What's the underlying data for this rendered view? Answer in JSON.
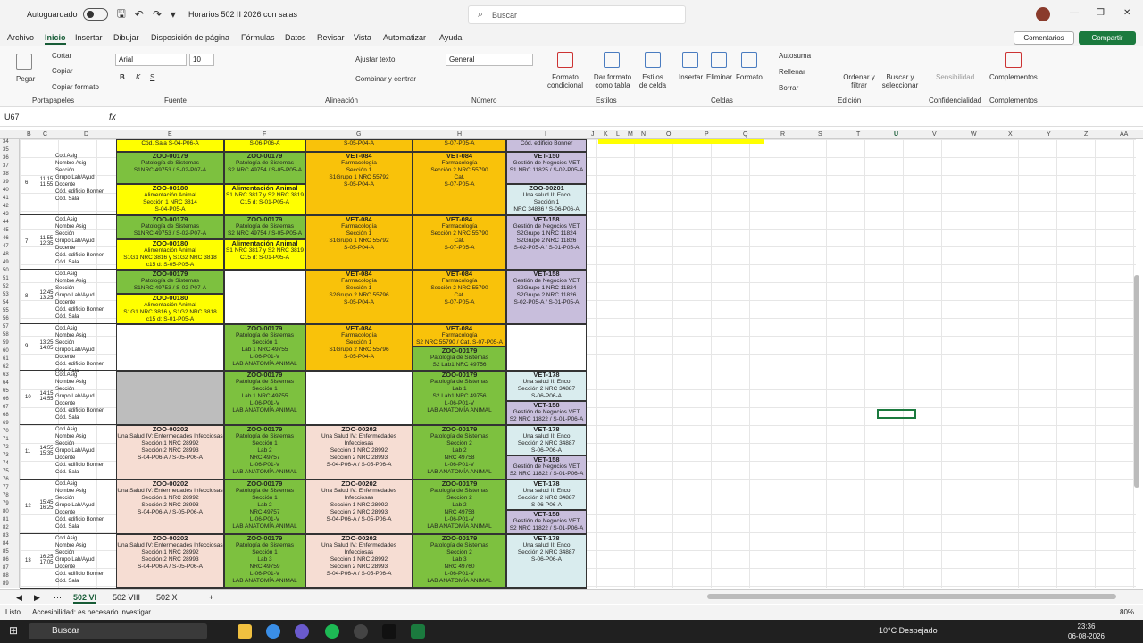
{
  "titlebar": {
    "autosave": "Autoguardado",
    "doc": "Horarios 502 II 2026 con salas",
    "search": "Buscar"
  },
  "menu": [
    "Archivo",
    "Inicio",
    "Insertar",
    "Dibujar",
    "Disposición de página",
    "Fórmulas",
    "Datos",
    "Revisar",
    "Vista",
    "Automatizar",
    "Ayuda"
  ],
  "buttons": {
    "comments": "Comentarios",
    "share": "Compartir"
  },
  "ribbon": {
    "paste": "Pegar",
    "cut": "Cortar",
    "copy": "Copiar",
    "format_copy": "Copiar formato",
    "clipboard": "Portapapeles",
    "font": "Arial",
    "size": "10",
    "font_group": "Fuente",
    "wrap": "Ajustar texto",
    "merge": "Combinar y centrar",
    "align_group": "Alineación",
    "numfmt": "General",
    "number_group": "Número",
    "cond": "Formato condicional",
    "table": "Dar formato como tabla",
    "styles_cell": "Estilos de celda",
    "styles_group": "Estilos",
    "insert": "Insertar",
    "delete": "Eliminar",
    "format": "Formato",
    "cells_group": "Celdas",
    "autosum": "Autosuma",
    "fill": "Rellenar",
    "clear": "Borrar",
    "sort": "Ordenar y filtrar",
    "find": "Buscar y seleccionar",
    "edit_group": "Edición",
    "sens": "Sensibilidad",
    "conf_group": "Confidencialidad",
    "addins": "Complementos",
    "addins_group": "Complementos"
  },
  "namebox": "U67",
  "columns": [
    "B",
    "C",
    "D",
    "E",
    "F",
    "G",
    "H",
    "I",
    "J",
    "K",
    "L",
    "M",
    "N",
    "O",
    "P",
    "Q",
    "R",
    "S",
    "T",
    "U",
    "V",
    "W",
    "X",
    "Y",
    "Z",
    "AA"
  ],
  "rows": [
    "34",
    "35",
    "36",
    "37",
    "38",
    "39",
    "40",
    "41",
    "42",
    "43",
    "44",
    "45",
    "46",
    "47",
    "48",
    "49",
    "50",
    "51",
    "52",
    "53",
    "54",
    "55",
    "56",
    "57",
    "58",
    "59",
    "60",
    "61",
    "62",
    "63",
    "64",
    "65",
    "66",
    "67",
    "68",
    "69",
    "70",
    "71",
    "72",
    "73",
    "74",
    "75",
    "76",
    "77",
    "78",
    "79",
    "80",
    "81",
    "82",
    "83",
    "84",
    "85",
    "86",
    "87",
    "88",
    "89"
  ],
  "row_labels": [
    "Cod.Asig",
    "Nombre Asig",
    "Sección",
    "Grupo Lab/Ayud",
    "Docente",
    "Cód. edificio Bonner",
    "Cód. Sala"
  ],
  "blocks": [
    {
      "num": "6",
      "time": "11:15 11:55"
    },
    {
      "num": "7",
      "time": "11:55 12:35"
    },
    {
      "num": "8",
      "time": "12:45 13:25"
    },
    {
      "num": "9",
      "time": "13:25 14:05"
    },
    {
      "num": "10",
      "time": "14:15 14:55"
    },
    {
      "num": "11",
      "time": "14:55 15:35"
    },
    {
      "num": "12",
      "time": "15:45 16:25"
    },
    {
      "num": "13",
      "time": "16:25 17:05"
    }
  ],
  "cells": {
    "top_e": "Cód. Sala S-04-P06-A",
    "top_f": "S-06-P06-A",
    "top_g": "S-05-P04-A",
    "top_h": "S-07-P05-A",
    "top_i": "Cód. edificio Bonner",
    "b6e1": [
      "ZOO-00179",
      "Patología de Sistemas",
      "S1NRC 49753 / S-02-P07-A"
    ],
    "b6e2": [
      "ZOO-00180",
      "Alimentación Animal",
      "Sección 1 NRC 3814",
      "S-04-P05-A"
    ],
    "b6f1": [
      "ZOO-00179",
      "Patología de Sistemas",
      "S2 NRC 49754 / S-05-P05-A"
    ],
    "b6f2": [
      "Alimentación Animal",
      "S1 NRC 3817 y S2 NRC 3819",
      "C15 d: S-01-P05-A"
    ],
    "b6g": [
      "VET-084",
      "Farmacología",
      "Sección 1",
      "S1Grupo 1 NRC 55792",
      "S-05-P04-A"
    ],
    "b6h": [
      "VET-084",
      "Farmacología",
      "Sección 2 NRC 55790",
      "Cat.",
      "S-07-P05-A"
    ],
    "b6i1": [
      "VET-150",
      "Gestión de Negocios VET",
      "S1 NRC 11825 / S-02-P05-A"
    ],
    "b6i2": [
      "ZOO-00201",
      "Una salud II: Enco",
      "Sección 1",
      "NRC 34886 / S-06-P06-A"
    ],
    "b7e1": [
      "ZOO-00179",
      "Patología de Sistemas",
      "S1NRC 49753 / S-02-P07-A"
    ],
    "b7e2": [
      "ZOO-00180",
      "Alimentación Animal",
      "S1G1 NRC 3816 y S1G2 NRC 3818",
      "c15 d: S-05-P05-A"
    ],
    "b7f1": [
      "ZOO-00179",
      "Patología de Sistemas",
      "S2 NRC 49754 / S-05-P05-A"
    ],
    "b7f2": [
      "Alimentación Animal",
      "S1 NRC 3817 y S2 NRC 3819",
      "C15 d: S-01-P05-A"
    ],
    "b7g": [
      "VET-084",
      "Farmacología",
      "Sección 1",
      "S1Grupo 1 NRC 55792",
      "S-05-P04-A"
    ],
    "b7h": [
      "VET-084",
      "Farmacología",
      "Sección 2 NRC 55790",
      "Cat.",
      "S-07-P05-A"
    ],
    "b7i": [
      "VET-158",
      "Gestión de Negocios VET",
      "S2Grupo 1 NRC 11824",
      "S2Grupo 2 NRC 11826",
      "S-02-P05-A / S-01-P05-A"
    ],
    "b8e1": [
      "ZOO-00179",
      "Patología de Sistemas",
      "S1NRC 49753 / S-02-P07-A"
    ],
    "b8e2": [
      "ZOO-00180",
      "Alimentación Animal",
      "S1G1 NRC 3816 y S1G2 NRC 3818",
      "c15 d: S-01-P05-A"
    ],
    "b8g": [
      "VET-084",
      "Farmacología",
      "Sección 1",
      "S2Grupo 2 NRC 55796",
      "S-05-P04-A"
    ],
    "b8h": [
      "VET-084",
      "Farmacología",
      "Sección 2 NRC 55790",
      "Cat.",
      "S-07-P05-A"
    ],
    "b8i": [
      "VET-158",
      "Gestión de Negocios VET",
      "S2Grupo 1 NRC 11824",
      "S2Grupo 2 NRC 11826",
      "S-02-P05-A / S-01-P05-A"
    ],
    "b9f": [
      "ZOO-00179",
      "Patología de Sistemas",
      "Sección 1",
      "Lab 1 NRC 49755",
      "L-06-P01-V",
      "LAB ANATOMÍA ANIMAL"
    ],
    "b9g": [
      "VET-084",
      "Farmacología",
      "Sección 1",
      "S1Grupo 2 NRC 55796",
      "S-05-P04-A"
    ],
    "b9h1": [
      "VET-084",
      "Farmacología",
      "S2 NRC 55790 / Cat. S-07-P05-A"
    ],
    "b9h2": [
      "ZOO-00179",
      "Patología de Sistemas",
      "S2 Lab1 NRC 49756"
    ],
    "b10f": [
      "ZOO-00179",
      "Patología de Sistemas",
      "Sección 1",
      "Lab 1 NRC 49755",
      "L-06-P01-V",
      "LAB ANATOMÍA ANIMAL"
    ],
    "b10h": [
      "ZOO-00179",
      "Patología de Sistemas",
      "Lab 1",
      "S2 Lab1 NRC 49756",
      "L-06-P01-V",
      "LAB ANATOMÍA ANIMAL"
    ],
    "b10i1": [
      "VET-178",
      "Una salud II: Enco",
      "Sección 2 NRC 34887",
      "S-06-P06-A"
    ],
    "b10i2": [
      "VET-158",
      "Gestión de Negocios VET",
      "S2 NRC 11822 / S-01-P06-A"
    ],
    "b11e": [
      "ZOO-00202",
      "Una Salud IV: Enfermedades Infecciosas",
      "Sección 1 NRC 28992",
      "Sección 2 NRC 28993",
      "S-04-P06-A / S-05-P06-A"
    ],
    "b11f": [
      "ZOO-00179",
      "Patología de Sistemas",
      "Sección 1",
      "Lab 2",
      "NRC 49757",
      "L-06-P01-V",
      "LAB ANATOMÍA ANIMAL"
    ],
    "b11g": [
      "ZOO-00202",
      "Una Salud IV: Enfermedades Infecciosas",
      "Sección 1 NRC 28992",
      "Sección 2 NRC 28993",
      "S-04-P06-A / S-05-P06-A"
    ],
    "b11h": [
      "ZOO-00179",
      "Patología de Sistemas",
      "Sección 2",
      "Lab 2",
      "NRC 49758",
      "L-06-P01-V",
      "LAB ANATOMÍA ANIMAL"
    ],
    "b11i1": [
      "VET-178",
      "Una salud II: Enco",
      "Sección 2 NRC 34887",
      "S-06-P06-A"
    ],
    "b11i2": [
      "VET-158",
      "Gestión de Negocios VET",
      "S2 NRC 11822 / S-01-P06-A"
    ],
    "b12e": [
      "ZOO-00202",
      "Una Salud IV: Enfermedades Infecciosas",
      "Sección 1 NRC 28992",
      "Sección 2 NRC 28993",
      "S-04-P06-A / S-05-P06-A"
    ],
    "b12f": [
      "ZOO-00179",
      "Patología de Sistemas",
      "Sección 1",
      "Lab 2",
      "NRC 49757",
      "L-06-P01-V",
      "LAB ANATOMÍA ANIMAL"
    ],
    "b12g": [
      "ZOO-00202",
      "Una Salud IV: Enfermedades Infecciosas",
      "Sección 1 NRC 28992",
      "Sección 2 NRC 28993",
      "S-04-P06-A / S-05-P06-A"
    ],
    "b12h": [
      "ZOO-00179",
      "Patología de Sistemas",
      "Sección 2",
      "Lab 2",
      "NRC 49758",
      "L-06-P01-V",
      "LAB ANATOMÍA ANIMAL"
    ],
    "b12i1": [
      "VET-178",
      "Una salud II: Enco",
      "Sección 2 NRC 34887",
      "S-06-P06-A"
    ],
    "b12i2": [
      "VET-158",
      "Gestión de Negocios VET",
      "S2 NRC 11822 / S-01-P06-A"
    ],
    "b13e": [
      "ZOO-00202",
      "Una Salud IV: Enfermedades Infecciosas",
      "Sección 1 NRC 28992",
      "Sección 2 NRC 28993",
      "S-04-P06-A / S-05-P06-A"
    ],
    "b13f": [
      "ZOO-00179",
      "Patología de Sistemas",
      "Sección 1",
      "Lab 3",
      "NRC 49759",
      "L-06-P01-V",
      "LAB ANATOMÍA ANIMAL"
    ],
    "b13g": [
      "ZOO-00202",
      "Una Salud IV: Enfermedades Infecciosas",
      "Sección 1 NRC 28992",
      "Sección 2 NRC 28993",
      "S-04-P06-A / S-05-P06-A"
    ],
    "b13h": [
      "ZOO-00179",
      "Patología de Sistemas",
      "Sección 2",
      "Lab 3",
      "NRC 49760",
      "L-06-P01-V",
      "LAB ANATOMÍA ANIMAL"
    ],
    "b13i": [
      "VET-178",
      "Una salud II: Enco",
      "Sección 2 NRC 34887",
      "S-06-P06-A"
    ]
  },
  "sheets": [
    "502 VI",
    "502 VIII",
    "502 X"
  ],
  "status": {
    "ready": "Listo",
    "access": "Accesibilidad: es necesario investigar",
    "zoom": "80%"
  },
  "taskbar": {
    "search": "Buscar",
    "weather": "10°C Despejado",
    "time": "23:36",
    "date": "06-08-2026"
  }
}
